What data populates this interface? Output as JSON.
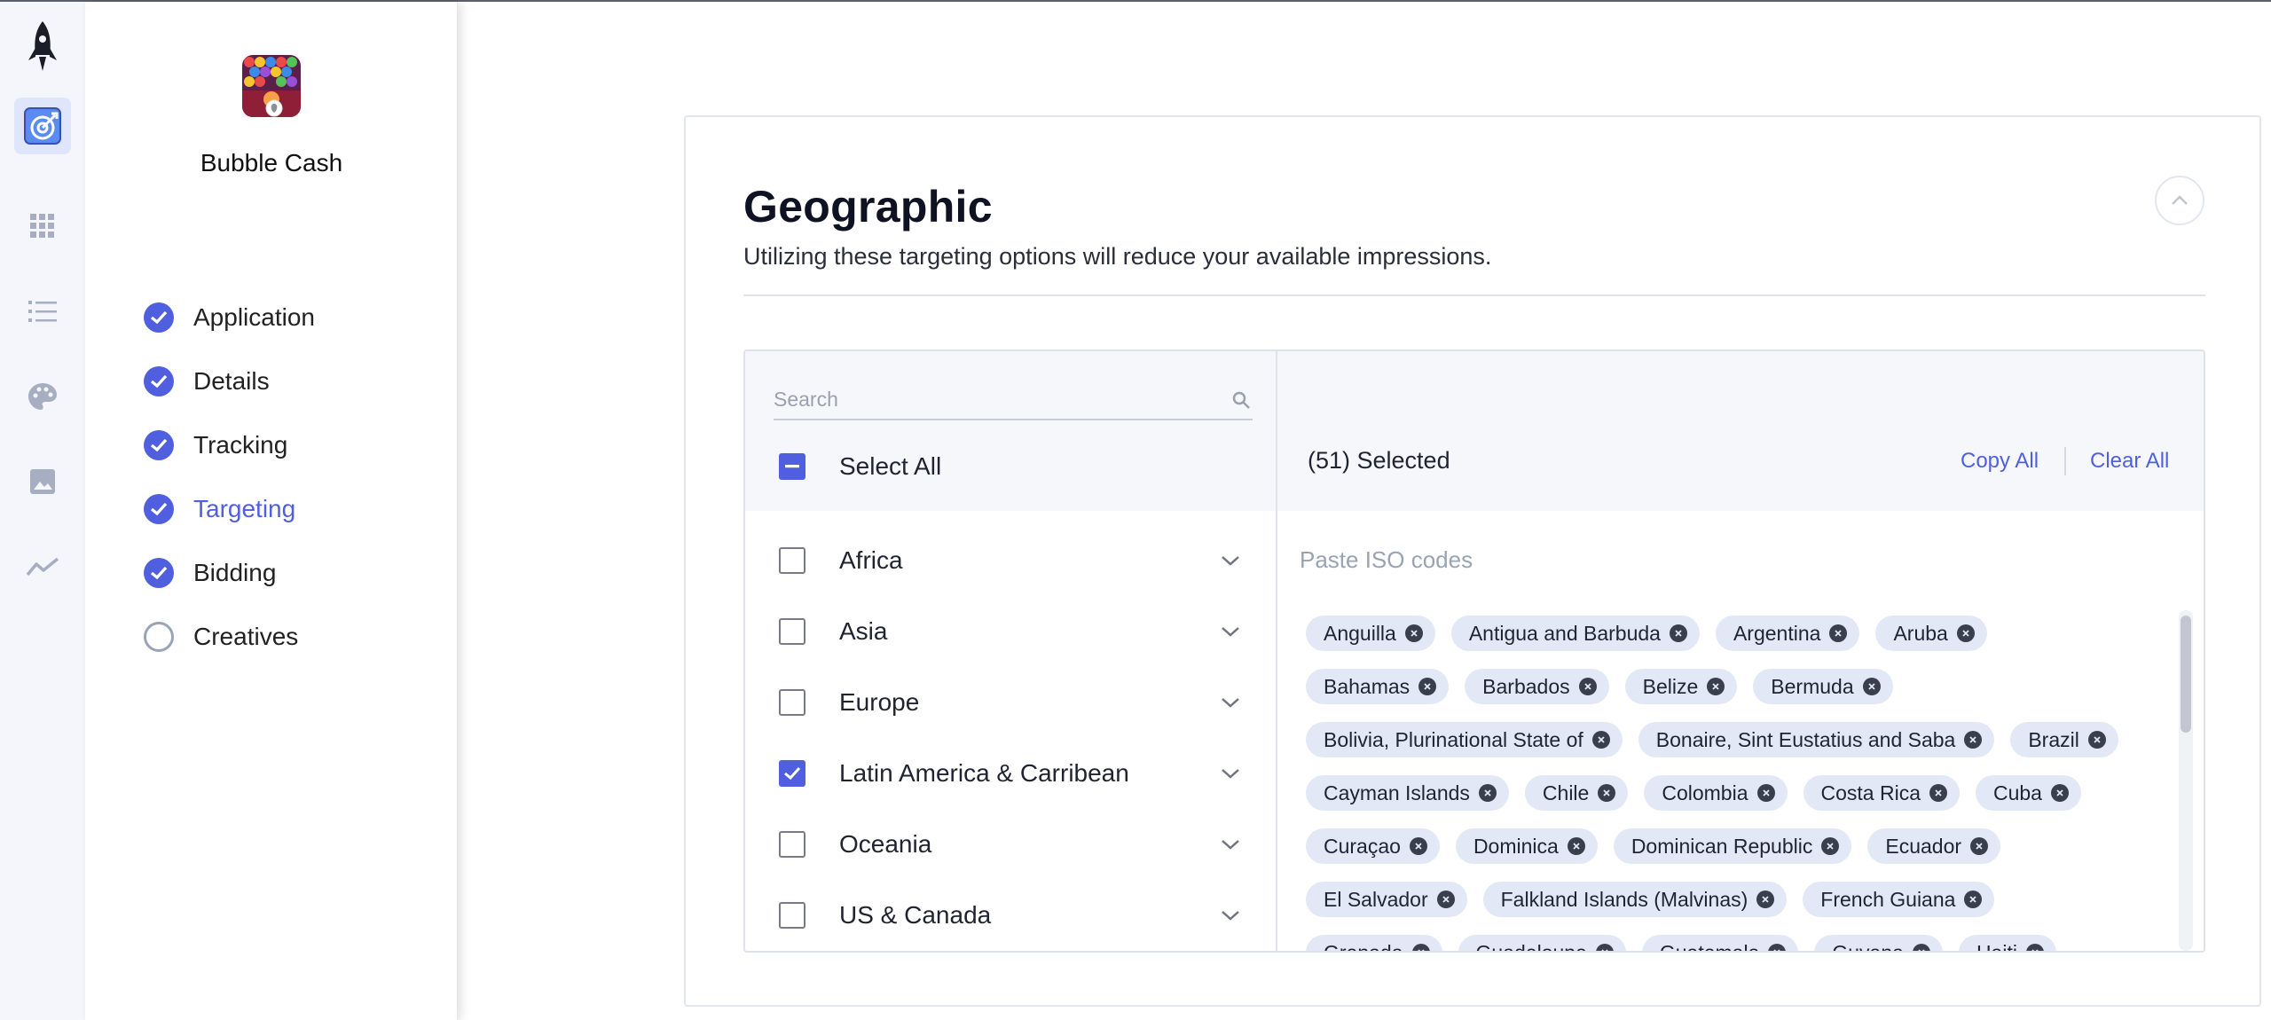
{
  "app": {
    "name": "Bubble Cash"
  },
  "rail": {
    "items": [
      {
        "icon": "rocket-icon"
      },
      {
        "icon": "target-icon",
        "active": true
      },
      {
        "icon": "grid-icon"
      },
      {
        "icon": "list-icon"
      },
      {
        "icon": "palette-icon"
      },
      {
        "icon": "image-icon"
      },
      {
        "icon": "trend-icon"
      }
    ]
  },
  "steps": [
    {
      "label": "Application",
      "status": "done"
    },
    {
      "label": "Details",
      "status": "done"
    },
    {
      "label": "Tracking",
      "status": "done"
    },
    {
      "label": "Targeting",
      "status": "current"
    },
    {
      "label": "Bidding",
      "status": "done"
    },
    {
      "label": "Creatives",
      "status": "todo"
    }
  ],
  "geo": {
    "title": "Geographic",
    "subtitle": "Utilizing these targeting options will reduce your available impressions.",
    "search_placeholder": "Search",
    "select_all_label": "Select All",
    "regions": [
      {
        "label": "Africa",
        "checked": false
      },
      {
        "label": "Asia",
        "checked": false
      },
      {
        "label": "Europe",
        "checked": false
      },
      {
        "label": "Latin America & Carribean",
        "checked": true
      },
      {
        "label": "Oceania",
        "checked": false
      },
      {
        "label": "US & Canada",
        "checked": false
      }
    ],
    "selected_label": "(51) Selected",
    "copy_all": "Copy All",
    "clear_all": "Clear All",
    "paste_placeholder": "Paste ISO codes",
    "chip_rows": [
      [
        "Anguilla",
        "Antigua and Barbuda",
        "Argentina",
        "Aruba"
      ],
      [
        "Bahamas",
        "Barbados",
        "Belize",
        "Bermuda"
      ],
      [
        "Bolivia, Plurinational State of",
        "Bonaire, Sint Eustatius and Saba",
        "Brazil"
      ],
      [
        "Cayman Islands",
        "Chile",
        "Colombia",
        "Costa Rica",
        "Cuba"
      ],
      [
        "Curaçao",
        "Dominica",
        "Dominican Republic",
        "Ecuador"
      ],
      [
        "El Salvador",
        "Falkland Islands (Malvinas)",
        "French Guiana"
      ],
      [
        "Grenada",
        "Guadeloupe",
        "Guatemala",
        "Guyana",
        "Haiti"
      ]
    ]
  },
  "colors": {
    "accent": "#4f5fe0",
    "chip_bg": "#e3e8f7",
    "rail_bg": "#f4f6fb"
  }
}
